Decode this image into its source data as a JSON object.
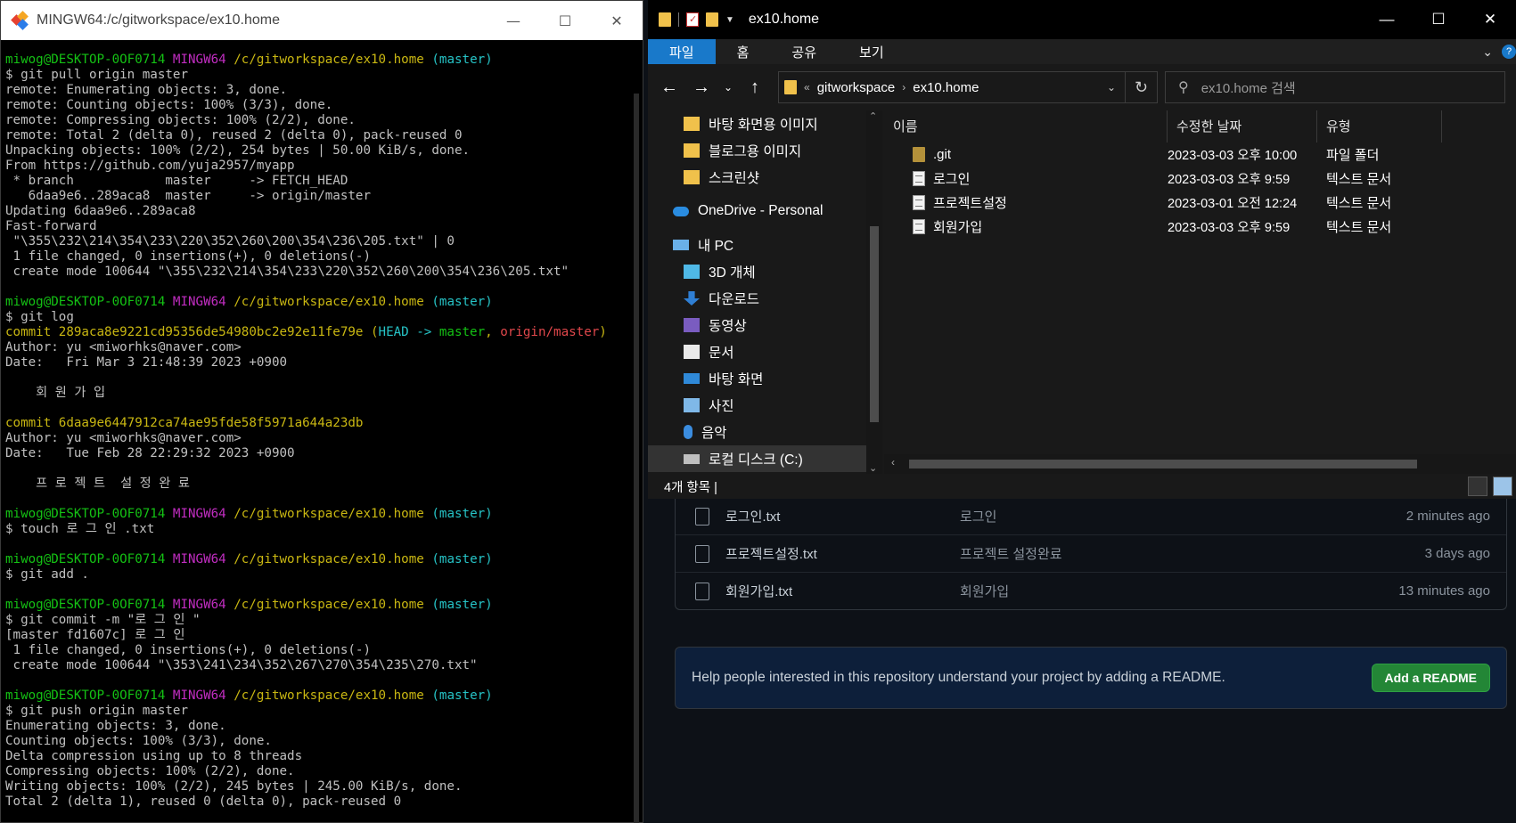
{
  "terminal": {
    "title": "MINGW64:/c/gitworkspace/ex10.home",
    "lines": [
      [
        [
          "c-green",
          "miwog@DESKTOP-0OF0714 "
        ],
        [
          "c-mag",
          "MINGW64 "
        ],
        [
          "c-yel",
          "/c/gitworkspace/ex10.home "
        ],
        [
          "c-cyan",
          "(master)"
        ]
      ],
      [
        [
          "c-gray",
          "$ git pull origin master"
        ]
      ],
      [
        [
          "c-gray",
          "remote: Enumerating objects: 3, done."
        ]
      ],
      [
        [
          "c-gray",
          "remote: Counting objects: 100% (3/3), done."
        ]
      ],
      [
        [
          "c-gray",
          "remote: Compressing objects: 100% (2/2), done."
        ]
      ],
      [
        [
          "c-gray",
          "remote: Total 2 (delta 0), reused 2 (delta 0), pack-reused 0"
        ]
      ],
      [
        [
          "c-gray",
          "Unpacking objects: 100% (2/2), 254 bytes | 50.00 KiB/s, done."
        ]
      ],
      [
        [
          "c-gray",
          "From https://github.com/yuja2957/myapp"
        ]
      ],
      [
        [
          "c-gray",
          " * branch            master     -> FETCH_HEAD"
        ]
      ],
      [
        [
          "c-gray",
          "   6daa9e6..289aca8  master     -> origin/master"
        ]
      ],
      [
        [
          "c-gray",
          "Updating 6daa9e6..289aca8"
        ]
      ],
      [
        [
          "c-gray",
          "Fast-forward"
        ]
      ],
      [
        [
          "c-gray",
          " \"\\355\\232\\214\\354\\233\\220\\352\\260\\200\\354\\236\\205.txt\" | 0"
        ]
      ],
      [
        [
          "c-gray",
          " 1 file changed, 0 insertions(+), 0 deletions(-)"
        ]
      ],
      [
        [
          "c-gray",
          " create mode 100644 \"\\355\\232\\214\\354\\233\\220\\352\\260\\200\\354\\236\\205.txt\""
        ]
      ],
      [],
      [
        [
          "c-green",
          "miwog@DESKTOP-0OF0714 "
        ],
        [
          "c-mag",
          "MINGW64 "
        ],
        [
          "c-yel",
          "/c/gitworkspace/ex10.home "
        ],
        [
          "c-cyan",
          "(master)"
        ]
      ],
      [
        [
          "c-gray",
          "$ git log"
        ]
      ],
      [
        [
          "c-yel",
          "commit 289aca8e9221cd95356de54980bc2e92e11fe79e "
        ],
        [
          "c-yel",
          "("
        ],
        [
          "c-cyan",
          "HEAD -> "
        ],
        [
          "c-green",
          "master"
        ],
        [
          "c-yel",
          ", "
        ],
        [
          "c-red",
          "origin/master"
        ],
        [
          "c-yel",
          ")"
        ]
      ],
      [
        [
          "c-gray",
          "Author: yu <miworhks@naver.com>"
        ]
      ],
      [
        [
          "c-gray",
          "Date:   Fri Mar 3 21:48:39 2023 +0900"
        ]
      ],
      [],
      [
        [
          "c-gray",
          "    회 원 가 입"
        ]
      ],
      [],
      [
        [
          "c-yel",
          "commit 6daa9e6447912ca74ae95fde58f5971a644a23db"
        ]
      ],
      [
        [
          "c-gray",
          "Author: yu <miworhks@naver.com>"
        ]
      ],
      [
        [
          "c-gray",
          "Date:   Tue Feb 28 22:29:32 2023 +0900"
        ]
      ],
      [],
      [
        [
          "c-gray",
          "    프 로 젝 트  설 정 완 료"
        ]
      ],
      [],
      [
        [
          "c-green",
          "miwog@DESKTOP-0OF0714 "
        ],
        [
          "c-mag",
          "MINGW64 "
        ],
        [
          "c-yel",
          "/c/gitworkspace/ex10.home "
        ],
        [
          "c-cyan",
          "(master)"
        ]
      ],
      [
        [
          "c-gray",
          "$ touch 로 그 인 .txt"
        ]
      ],
      [],
      [
        [
          "c-green",
          "miwog@DESKTOP-0OF0714 "
        ],
        [
          "c-mag",
          "MINGW64 "
        ],
        [
          "c-yel",
          "/c/gitworkspace/ex10.home "
        ],
        [
          "c-cyan",
          "(master)"
        ]
      ],
      [
        [
          "c-gray",
          "$ git add ."
        ]
      ],
      [],
      [
        [
          "c-green",
          "miwog@DESKTOP-0OF0714 "
        ],
        [
          "c-mag",
          "MINGW64 "
        ],
        [
          "c-yel",
          "/c/gitworkspace/ex10.home "
        ],
        [
          "c-cyan",
          "(master)"
        ]
      ],
      [
        [
          "c-gray",
          "$ git commit -m \"로 그 인 \""
        ]
      ],
      [
        [
          "c-gray",
          "[master fd1607c] 로 그 인"
        ]
      ],
      [
        [
          "c-gray",
          " 1 file changed, 0 insertions(+), 0 deletions(-)"
        ]
      ],
      [
        [
          "c-gray",
          " create mode 100644 \"\\353\\241\\234\\352\\267\\270\\354\\235\\270.txt\""
        ]
      ],
      [],
      [
        [
          "c-green",
          "miwog@DESKTOP-0OF0714 "
        ],
        [
          "c-mag",
          "MINGW64 "
        ],
        [
          "c-yel",
          "/c/gitworkspace/ex10.home "
        ],
        [
          "c-cyan",
          "(master)"
        ]
      ],
      [
        [
          "c-gray",
          "$ git push origin master"
        ]
      ],
      [
        [
          "c-gray",
          "Enumerating objects: 3, done."
        ]
      ],
      [
        [
          "c-gray",
          "Counting objects: 100% (3/3), done."
        ]
      ],
      [
        [
          "c-gray",
          "Delta compression using up to 8 threads"
        ]
      ],
      [
        [
          "c-gray",
          "Compressing objects: 100% (2/2), done."
        ]
      ],
      [
        [
          "c-gray",
          "Writing objects: 100% (2/2), 245 bytes | 245.00 KiB/s, done."
        ]
      ],
      [
        [
          "c-gray",
          "Total 2 (delta 1), reused 0 (delta 0), pack-reused 0"
        ]
      ]
    ]
  },
  "explorer": {
    "title": "ex10.home",
    "ribbon_tabs": [
      "파일",
      "홈",
      "공유",
      "보기"
    ],
    "address": {
      "parent": "gitworkspace",
      "current": "ex10.home"
    },
    "search_placeholder": "ex10.home 검색",
    "nav_items": [
      {
        "label": "바탕 화면용 이미지",
        "icon": "folder-icon",
        "level": 1
      },
      {
        "label": "블로그용 이미지",
        "icon": "folder-icon",
        "level": 1
      },
      {
        "label": "스크린샷",
        "icon": "folder-icon",
        "level": 1
      },
      {
        "label": "OneDrive - Personal",
        "icon": "onedrive-icon",
        "level": 0
      },
      {
        "label": "내 PC",
        "icon": "pc-icon",
        "level": 0
      },
      {
        "label": "3D 개체",
        "icon": "3d-objects-icon",
        "level": 1
      },
      {
        "label": "다운로드",
        "icon": "download-icon",
        "level": 1
      },
      {
        "label": "동영상",
        "icon": "video-icon",
        "level": 1
      },
      {
        "label": "문서",
        "icon": "document-icon",
        "level": 1
      },
      {
        "label": "바탕 화면",
        "icon": "desktop-icon",
        "level": 1
      },
      {
        "label": "사진",
        "icon": "pictures-icon",
        "level": 1
      },
      {
        "label": "음악",
        "icon": "music-icon",
        "level": 1
      },
      {
        "label": "로컬 디스크 (C:)",
        "icon": "drive-icon",
        "level": 1
      }
    ],
    "columns": [
      "이름",
      "수정한 날짜",
      "유형"
    ],
    "files": [
      {
        "name": ".git",
        "date": "2023-03-03 오후 10:00",
        "type": "파일 폴더",
        "icon": "folder-icon"
      },
      {
        "name": "로그인",
        "date": "2023-03-03 오후 9:59",
        "type": "텍스트 문서",
        "icon": "text-file-icon"
      },
      {
        "name": "프로젝트설정",
        "date": "2023-03-01 오전 12:24",
        "type": "텍스트 문서",
        "icon": "text-file-icon"
      },
      {
        "name": "회원가입",
        "date": "2023-03-03 오후 9:59",
        "type": "텍스트 문서",
        "icon": "text-file-icon"
      }
    ],
    "status": "4개 항목  |"
  },
  "github": {
    "files": [
      {
        "name": "로그인.txt",
        "message": "로그인",
        "age": "2 minutes ago"
      },
      {
        "name": "프로젝트설정.txt",
        "message": "프로젝트 설정완료",
        "age": "3 days ago"
      },
      {
        "name": "회원가입.txt",
        "message": "회원가입",
        "age": "13 minutes ago"
      }
    ],
    "readme_text": "Help people interested in this repository understand your project by adding a README.",
    "readme_button": "Add a README"
  }
}
